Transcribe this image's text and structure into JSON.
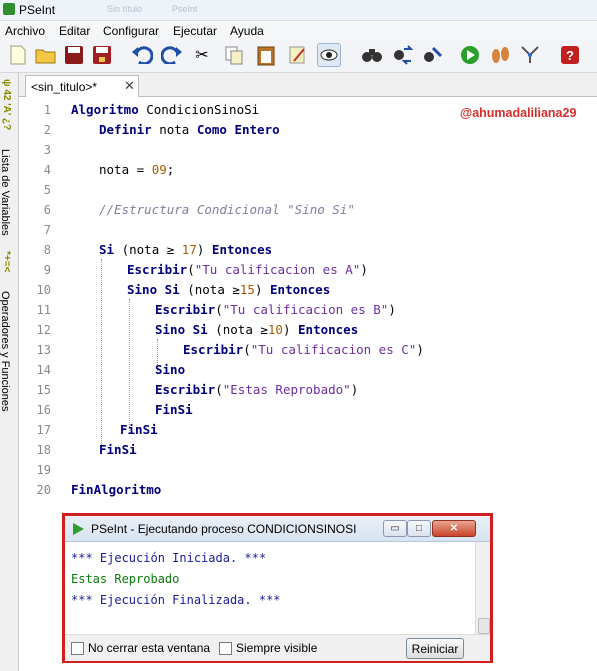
{
  "window": {
    "title": "PSeInt",
    "ghost_title_1": "Sin título",
    "ghost_title_2": "PseInt"
  },
  "menu": [
    "Archivo",
    "Editar",
    "Configurar",
    "Ejecutar",
    "Ayuda"
  ],
  "toolbar_icons": [
    "new-file-icon",
    "open-folder-icon",
    "save-icon",
    "save-as-icon",
    "undo-icon",
    "redo-icon",
    "cut-icon",
    "copy-icon",
    "paste-icon",
    "edit-icon",
    "eye-icon",
    "binoculars-icon",
    "replace-icon",
    "tools-icon",
    "run-icon",
    "step-icon",
    "flowchart-icon",
    "help-icon"
  ],
  "side_panel": {
    "variables_label": "Lista de Variables",
    "operators_label": "Operadores y Funciones",
    "symbols_top": "ψ 42 'A' ¿?",
    "symbols_mid": "*+=<"
  },
  "tab": {
    "label": "<sin_titulo>*",
    "close": "✕"
  },
  "editor": {
    "watermark": "@ahumadaliliana29",
    "line_numbers": [
      "1",
      "2",
      "3",
      "4",
      "5",
      "6",
      "7",
      "8",
      "9",
      "10",
      "11",
      "12",
      "13",
      "14",
      "15",
      "16",
      "17",
      "18",
      "19",
      "20"
    ],
    "lines": {
      "l1_kw": "Algoritmo",
      "l1_name": " CondicionSinoSi",
      "l2_kw1": "Definir",
      "l2_var": " nota ",
      "l2_kw2": "Como Entero",
      "l4_a": "nota = ",
      "l4_num": "09",
      "l4_b": ";",
      "l6_cmt": "//Estructura Condicional \"Sino Si\"",
      "l8_kw1": "Si",
      "l8_a": " (nota ≥ ",
      "l8_num": "17",
      "l8_b": ") ",
      "l8_kw2": "Entonces",
      "l9_kw": "Escribir",
      "l9_a": "(",
      "l9_str": "\"Tu calificacion es A\"",
      "l9_b": ")",
      "l10_kw1": "Sino Si",
      "l10_a": " (nota ≥",
      "l10_num": "15",
      "l10_b": ") ",
      "l10_kw2": "Entonces",
      "l11_kw": "Escribir",
      "l11_a": "(",
      "l11_str": "\"Tu calificacion es B\"",
      "l11_b": ")",
      "l12_kw1": "Sino Si",
      "l12_a": " (nota ≥",
      "l12_num": "10",
      "l12_b": ") ",
      "l12_kw2": "Entonces",
      "l13_kw": "Escribir",
      "l13_a": "(",
      "l13_str": "\"Tu calificacion es C\"",
      "l13_b": ")",
      "l14_kw": "Sino",
      "l15_kw": "Escribir",
      "l15_a": "(",
      "l15_str": "\"Estas Reprobado\"",
      "l15_b": ")",
      "l16_kw": "FinSi",
      "l17_kw": "FinSi",
      "l18_kw": "FinSi",
      "l20_kw": "FinAlgoritmo"
    }
  },
  "console": {
    "title": "PSeInt - Ejecutando proceso CONDICIONSINOSI",
    "minimize": "▭",
    "maximize": "□",
    "close": "✕",
    "output": [
      "*** Ejecución Iniciada. ***",
      "Estas Reprobado",
      "*** Ejecución Finalizada. ***"
    ],
    "no_cerrar_label": "No cerrar esta ventana",
    "siempre_visible_label": "Siempre visible",
    "reiniciar_label": "Reiniciar"
  },
  "colors": {
    "keyword": "#00007f",
    "number": "#a55b00",
    "string": "#6b2f9e",
    "comment": "#7f7f9f",
    "watermark": "#d62c2c",
    "console_frame": "#d01f1f"
  }
}
